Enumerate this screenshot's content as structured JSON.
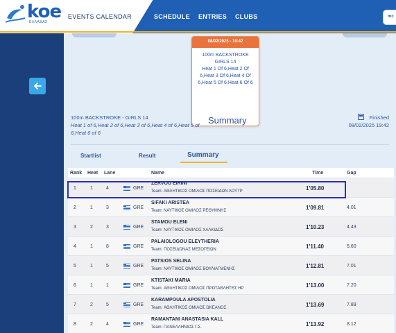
{
  "header": {
    "logo_text": "koe",
    "logo_sub": "ΕΛΛΑΔΑΣ",
    "nav": {
      "events": "EVENTS CALENDAR",
      "schedule": "SCHEDULE",
      "entries": "ENTRIES",
      "clubs": "CLUBS",
      "badge": "mc"
    },
    "accent": "#f0b429",
    "brand": "#1f5fb4"
  },
  "heat_card": {
    "date": "08/02/2025 - 19:42",
    "event": "100m BACKSTROKE GIRLS 14",
    "heats": "Heat 1 Of 6,Heat 2 Of 6,Heat 3 Of 6,Heat 4 Of 6,Heat 5 Of 6,Heat 6 Of 6"
  },
  "event": {
    "name": "100m BACKSTROKE - GIRLS 14",
    "heats": "Heat 1 of 6,Heat 2 of 6,Heat 3 of 6,Heat 4 of 6,Heat 5 of 6,Heat 6 of 6",
    "title": "Summary",
    "status": "Finished",
    "datetime": "08/02/2025 19:42"
  },
  "tabs": [
    "Startlist",
    "Result",
    "Summary"
  ],
  "active_tab": "Summary",
  "table": {
    "columns": [
      "Rank",
      "Heat",
      "Lane",
      "Name",
      "Time",
      "Gap"
    ],
    "rows": [
      {
        "rank": "1",
        "heat": "1",
        "lane": "4",
        "nation": "GRE",
        "name": "ZERVOU EIRINI",
        "team": "Team: ΑΘΛΗΤΙΚΟΣ ΟΜΙΛΟΣ ΠΟΣΕΙΔΩΝ ΛΟΥΤΡ",
        "time": "1'05.80",
        "gap": ""
      },
      {
        "rank": "2",
        "heat": "1",
        "lane": "3",
        "nation": "GRE",
        "name": "SIFAKI ARISTEA",
        "team": "Team: ΝΑΥΤΙΚΟΣ ΟΜΙΛΟΣ ΡΕΘΥΜΝΗΣ",
        "time": "1'09.81",
        "gap": "4.01"
      },
      {
        "rank": "3",
        "heat": "2",
        "lane": "3",
        "nation": "GRE",
        "name": "STAMOU ELENI",
        "team": "Team: ΝΑΥΤΙΚΟΣ ΟΜΙΛΟΣ ΧΑΛΚΙΔΟΣ",
        "time": "1'10.23",
        "gap": "4.43"
      },
      {
        "rank": "4",
        "heat": "1",
        "lane": "8",
        "nation": "GRE",
        "name": "PALAIOLOGOU ELEYTHERIA",
        "team": "Team: ΠΟΣΕΙΔΩΝΑΣ ΜΕΣΟΓΕΙΩΝ",
        "time": "1'11.40",
        "gap": "5.60"
      },
      {
        "rank": "5",
        "heat": "1",
        "lane": "5",
        "nation": "GRE",
        "name": "PATSIOS SELINA",
        "team": "Team: ΝΑΥΤΙΚΟΣ ΟΜΙΛΟΣ ΒΟΥΛΙΑΓΜΕΝΗΣ",
        "time": "1'12.81",
        "gap": "7.01"
      },
      {
        "rank": "6",
        "heat": "1",
        "lane": "1",
        "nation": "GRE",
        "name": "KTISTAKI MARIA",
        "team": "Team: ΑΘΛΗΤΙΚΟΣ ΟΜΙΛΟΣ ΠΡΩΤΑΘΛΗΤΕΣ ΗΡ",
        "time": "1'13.00",
        "gap": "7.20"
      },
      {
        "rank": "7",
        "heat": "2",
        "lane": "5",
        "nation": "GRE",
        "name": "KARAMPOULA APOSTOLIA",
        "team": "Team: ΑΘΛΗΤΙΚΟΣ ΟΜΙΛΟΣ ΩΚΕΑΝΟΣ",
        "time": "1'13.69",
        "gap": "7.89"
      },
      {
        "rank": "8",
        "heat": "2",
        "lane": "4",
        "nation": "GRE",
        "name": "RAMANTANI ANASTASIA KALL",
        "team": "Team: ΠΑΝΕΛΛΗΝΙΟΣ Γ.Σ.",
        "time": "1'13.92",
        "gap": "8.12"
      }
    ]
  },
  "icons": {
    "back": "arrow-left-icon",
    "calendar": "calendar-check-icon",
    "flag": "greece-flag-icon"
  }
}
